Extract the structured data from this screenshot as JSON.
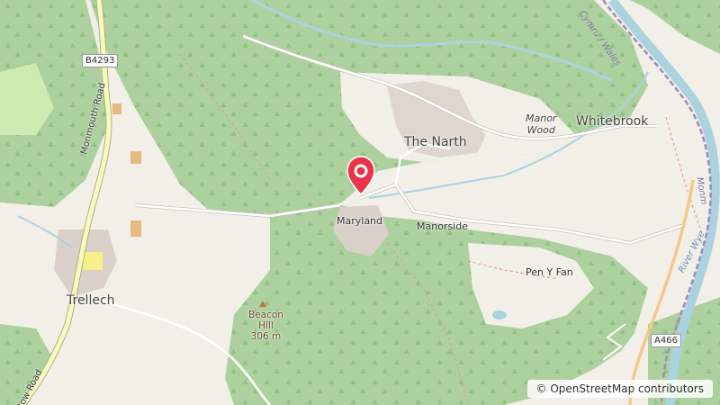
{
  "map": {
    "places": {
      "the_narth": "The Narth",
      "whitebrook": "Whitebrook",
      "maryland": "Maryland",
      "manorside": "Manorside",
      "pen_y_fan": "Pen Y Fan",
      "trellech": "Trellech",
      "manor_wood_1": "Manor",
      "manor_wood_2": "Wood",
      "beacon_hill_1": "Beacon",
      "beacon_hill_2": "Hill",
      "beacon_hill_elev": "306 m"
    },
    "roads": {
      "b4293": "B4293",
      "a466": "A466",
      "monmouth_road": "Monmouth Road",
      "tow_road": "tow Road"
    },
    "water": {
      "river_wye": "River Wye",
      "cymru_wales": "Cymru / Wales",
      "monmouth_edge": "Monm"
    },
    "marker": {
      "color": "#e8334a"
    },
    "attribution": "© OpenStreetMap contributors"
  }
}
